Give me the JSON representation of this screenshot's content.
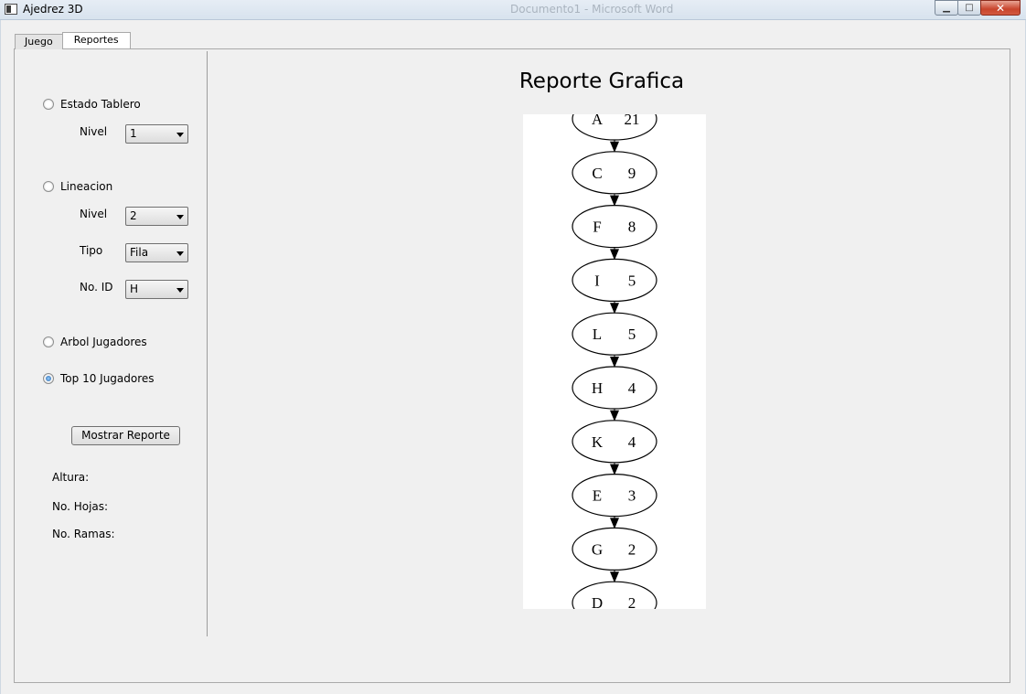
{
  "window": {
    "title": "Ajedrez 3D",
    "background_title": "Documento1 - Microsoft Word",
    "minimize_glyph": "▁",
    "maximize_glyph": "□",
    "close_glyph": "✕"
  },
  "tabs": [
    {
      "label": "Juego",
      "active": false
    },
    {
      "label": "Reportes",
      "active": true
    }
  ],
  "sidebar": {
    "estado_tablero": {
      "label": "Estado Tablero",
      "checked": false,
      "nivel_label": "Nivel",
      "nivel_value": "1"
    },
    "lineacion": {
      "label": "Lineacion",
      "checked": false,
      "nivel_label": "Nivel",
      "nivel_value": "2",
      "tipo_label": "Tipo",
      "tipo_value": "Fila",
      "noid_label": "No. ID",
      "noid_value": "H"
    },
    "arbol": {
      "label": "Arbol Jugadores",
      "checked": false
    },
    "top10": {
      "label": "Top 10 Jugadores",
      "checked": true
    },
    "show_button": "Mostrar Reporte",
    "stats": {
      "altura": "Altura:",
      "hojas": "No. Hojas:",
      "ramas": "No. Ramas:"
    }
  },
  "report": {
    "title": "Reporte Grafica",
    "nodes": [
      {
        "id": "A",
        "value": "21"
      },
      {
        "id": "C",
        "value": "9"
      },
      {
        "id": "F",
        "value": "8"
      },
      {
        "id": "I",
        "value": "5"
      },
      {
        "id": "L",
        "value": "5"
      },
      {
        "id": "H",
        "value": "4"
      },
      {
        "id": "K",
        "value": "4"
      },
      {
        "id": "E",
        "value": "3"
      },
      {
        "id": "G",
        "value": "2"
      },
      {
        "id": "D",
        "value": "2"
      }
    ]
  }
}
